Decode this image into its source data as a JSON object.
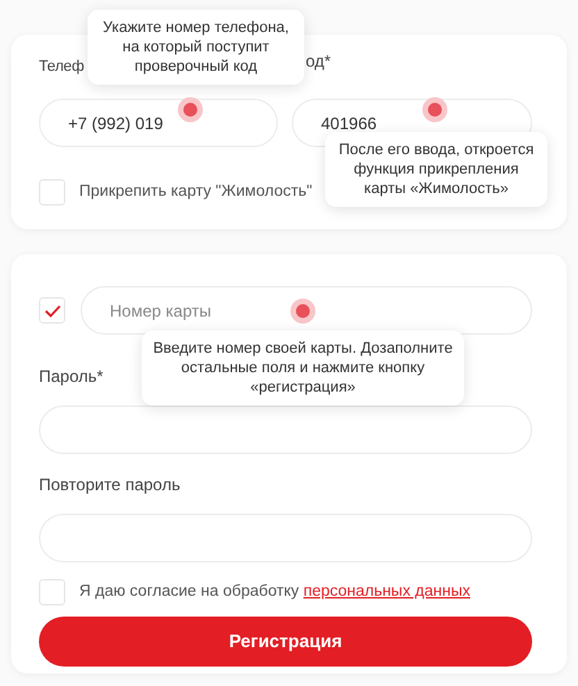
{
  "phone_card": {
    "phone_label": "Телеф",
    "code_label": "од*",
    "phone_field": {
      "value": "+7 (992) 019"
    },
    "code_field": {
      "value": "401966"
    },
    "attach_card": {
      "label": "Прикрепить карту \"Жимолость\"",
      "checked": false
    }
  },
  "tooltips": [
    {
      "text": "Укажите номер телефона, на который поступит проверочный код"
    },
    {
      "text": "После его ввода, откроется функция прикрепления карты «Жимолость»"
    },
    {
      "text": "Введите номер своей карты. Дозаполните остальные поля и нажмите кнопку «регистрация»"
    }
  ],
  "register_card": {
    "card_checkbox": {
      "checked": true
    },
    "card_field": {
      "placeholder": "Номер карты"
    },
    "password_label": "Пароль*",
    "repeat_label": "Повторите пароль",
    "consent": {
      "checked": false,
      "text": "Я даю согласие на обработку",
      "link": "персональных данных"
    },
    "submit": "Регистрация"
  }
}
